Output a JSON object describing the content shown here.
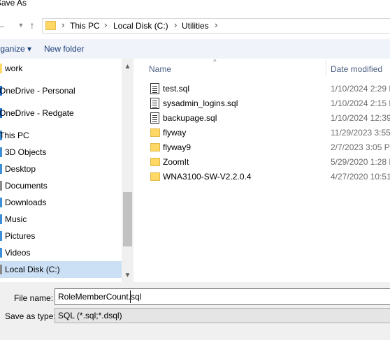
{
  "window": {
    "title": "Save As"
  },
  "nav": {
    "back_glyph": "←",
    "up_glyph": "↑",
    "breadcrumb": [
      "This PC",
      "Local Disk (C:)",
      "Utilities"
    ],
    "sep_glyph": "›",
    "folder_icon": "folder-icon"
  },
  "toolbar": {
    "organize_label": "Organize",
    "organize_arrow": "▾",
    "new_folder_label": "New folder"
  },
  "sidebar": {
    "items": [
      {
        "label": "work",
        "icon": "folder-icon",
        "icon_color": "#ffd764"
      },
      {
        "label": "OneDrive - Personal",
        "icon": "cloud-icon",
        "icon_color": "#1f6fd0"
      },
      {
        "label": "OneDrive - Redgate",
        "icon": "cloud-icon",
        "icon_color": "#1f6fd0"
      },
      {
        "label": "This PC",
        "icon": "computer-icon",
        "icon_color": "#3c8fd6"
      },
      {
        "label": "3D Objects",
        "icon": "cube-icon",
        "icon_color": "#3c8fd6"
      },
      {
        "label": "Desktop",
        "icon": "desktop-icon",
        "icon_color": "#3c8fd6"
      },
      {
        "label": "Documents",
        "icon": "documents-icon",
        "icon_color": "#8a8a8a"
      },
      {
        "label": "Downloads",
        "icon": "downloads-icon",
        "icon_color": "#3c8fd6"
      },
      {
        "label": "Music",
        "icon": "music-icon",
        "icon_color": "#3c8fd6"
      },
      {
        "label": "Pictures",
        "icon": "pictures-icon",
        "icon_color": "#3c8fd6"
      },
      {
        "label": "Videos",
        "icon": "videos-icon",
        "icon_color": "#3c8fd6"
      },
      {
        "label": "Local Disk (C:)",
        "icon": "drive-icon",
        "icon_color": "#8a8a8a",
        "selected": true
      }
    ],
    "scroll_up": "▲",
    "scroll_down": "▼"
  },
  "filelist": {
    "columns": {
      "name": "Name",
      "date": "Date modified"
    },
    "sort_glyph": "^",
    "rows": [
      {
        "name": "test.sql",
        "date": "1/10/2024 2:29 P",
        "type": "sql"
      },
      {
        "name": "sysadmin_logins.sql",
        "date": "1/10/2024 2:15 P",
        "type": "sql"
      },
      {
        "name": "backupage.sql",
        "date": "1/10/2024 12:39",
        "type": "sql"
      },
      {
        "name": "flyway",
        "date": "11/29/2023 3:55",
        "type": "folder"
      },
      {
        "name": "flyway9",
        "date": "2/7/2023 3:05 PN",
        "type": "folder"
      },
      {
        "name": "ZoomIt",
        "date": "5/29/2020 1:28 P",
        "type": "folder"
      },
      {
        "name": "WNA3100-SW-V2.2.0.4",
        "date": "4/27/2020 10:51",
        "type": "folder"
      }
    ]
  },
  "save": {
    "file_name_label": "File name:",
    "file_name_value": "RoleMemberCount.sql",
    "save_as_type_label": "Save as type:",
    "save_as_type_value": "SQL (*.sql;*.dsql)"
  }
}
